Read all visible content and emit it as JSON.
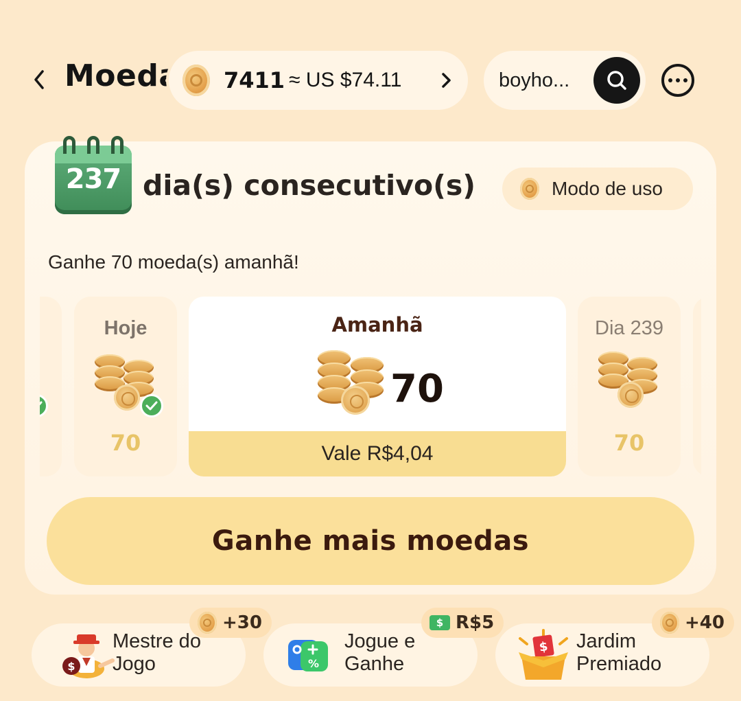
{
  "header": {
    "title": "Moedas",
    "balance_coins": "7411",
    "balance_usd": "≈ US $74.11",
    "search_text": "boyho..."
  },
  "streak": {
    "days": "237",
    "text": "dia(s) consecutivo(s)",
    "usage_label": "Modo de uso",
    "tomorrow_message": "Ganhe 70 moeda(s) amanhã!"
  },
  "days": [
    {
      "label": "Hoje",
      "value": "70",
      "checked": true
    },
    {
      "label": "Amanhã",
      "value": "70",
      "worth": "Vale R$4,04"
    },
    {
      "label": "Dia 239",
      "value": "70"
    }
  ],
  "earn_button": "Ganhe mais moedas",
  "shortcuts": [
    {
      "label_line1": "Mestre do",
      "label_line2": "Jogo",
      "badge": "+30",
      "icon": "game-master-icon"
    },
    {
      "label_line1": "Jogue e",
      "label_line2": "Ganhe",
      "badge": "R$5",
      "icon": "play-earn-icon"
    },
    {
      "label_line1": "Jardim",
      "label_line2": "Premiado",
      "badge": "+40",
      "icon": "prize-box-icon"
    }
  ],
  "colors": {
    "background": "#fde9cb",
    "accent_yellow": "#fbe09b",
    "coin_gold": "#e5a24d",
    "check_green": "#4cae5a"
  }
}
